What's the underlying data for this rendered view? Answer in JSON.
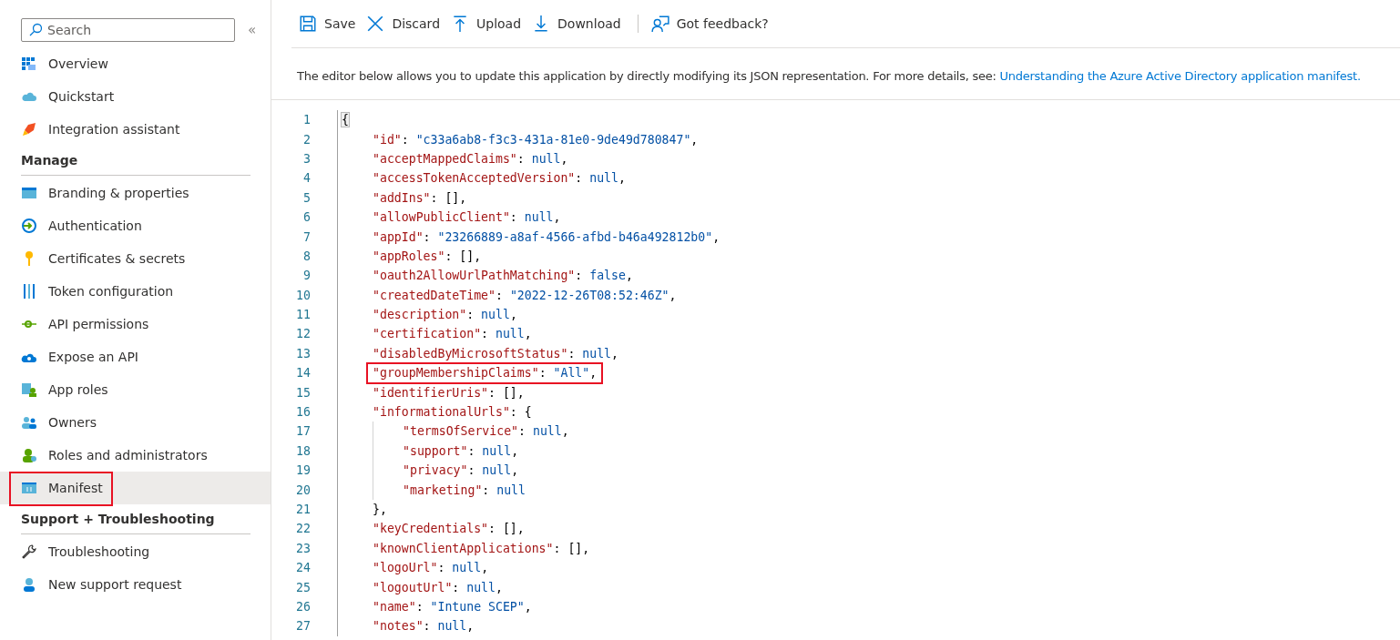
{
  "sidebar": {
    "search": {
      "placeholder": "Search"
    },
    "collapse": "«",
    "sections": [
      {
        "items": [
          {
            "label": "Overview",
            "selected": false,
            "highlighted": false
          },
          {
            "label": "Quickstart",
            "selected": false,
            "highlighted": false
          },
          {
            "label": "Integration assistant",
            "selected": false,
            "highlighted": false
          }
        ]
      },
      {
        "heading": "Manage",
        "items": [
          {
            "label": "Branding & properties",
            "selected": false,
            "highlighted": false
          },
          {
            "label": "Authentication",
            "selected": false,
            "highlighted": false
          },
          {
            "label": "Certificates & secrets",
            "selected": false,
            "highlighted": false
          },
          {
            "label": "Token configuration",
            "selected": false,
            "highlighted": false
          },
          {
            "label": "API permissions",
            "selected": false,
            "highlighted": false
          },
          {
            "label": "Expose an API",
            "selected": false,
            "highlighted": false
          },
          {
            "label": "App roles",
            "selected": false,
            "highlighted": false
          },
          {
            "label": "Owners",
            "selected": false,
            "highlighted": false
          },
          {
            "label": "Roles and administrators",
            "selected": false,
            "highlighted": false
          },
          {
            "label": "Manifest",
            "selected": true,
            "highlighted": true
          }
        ]
      },
      {
        "heading": "Support + Troubleshooting",
        "items": [
          {
            "label": "Troubleshooting",
            "selected": false,
            "highlighted": false
          },
          {
            "label": "New support request",
            "selected": false,
            "highlighted": false
          }
        ]
      }
    ]
  },
  "toolbar": [
    {
      "label": "Save",
      "kind": "save"
    },
    {
      "label": "Discard",
      "kind": "discard"
    },
    {
      "label": "Upload",
      "kind": "upload"
    },
    {
      "label": "Download",
      "kind": "download"
    },
    {
      "label": "Got feedback?",
      "kind": "feedback"
    }
  ],
  "description": {
    "text": "The editor below allows you to update this application by directly modifying its JSON representation. For more details, see:",
    "link": "Understanding the Azure Active Directory application manifest."
  },
  "editor": {
    "lines": [
      {
        "number": "1",
        "tokens": [
          {
            "kind": "punct",
            "t": "{"
          }
        ],
        "children": [
          {
            "number": "2",
            "tokens": [
              {
                "kind": "key",
                "t": "\"id\""
              },
              {
                "kind": "punct",
                "t": ": "
              },
              {
                "kind": "string",
                "t": "\"c33a6ab8-f3c3-431a-81e0-9de49d780847\""
              },
              {
                "kind": "punct",
                "t": ","
              }
            ]
          },
          {
            "number": "3",
            "tokens": [
              {
                "kind": "key",
                "t": "\"acceptMappedClaims\""
              },
              {
                "kind": "punct",
                "t": ": "
              },
              {
                "kind": "literal",
                "t": "null"
              },
              {
                "kind": "punct",
                "t": ","
              }
            ]
          },
          {
            "number": "4",
            "tokens": [
              {
                "kind": "key",
                "t": "\"accessTokenAcceptedVersion\""
              },
              {
                "kind": "punct",
                "t": ": "
              },
              {
                "kind": "literal",
                "t": "null"
              },
              {
                "kind": "punct",
                "t": ","
              }
            ]
          },
          {
            "number": "5",
            "tokens": [
              {
                "kind": "key",
                "t": "\"addIns\""
              },
              {
                "kind": "punct",
                "t": ": [],"
              }
            ]
          },
          {
            "number": "6",
            "tokens": [
              {
                "kind": "key",
                "t": "\"allowPublicClient\""
              },
              {
                "kind": "punct",
                "t": ": "
              },
              {
                "kind": "literal",
                "t": "null"
              },
              {
                "kind": "punct",
                "t": ","
              }
            ]
          },
          {
            "number": "7",
            "tokens": [
              {
                "kind": "key",
                "t": "\"appId\""
              },
              {
                "kind": "punct",
                "t": ": "
              },
              {
                "kind": "string",
                "t": "\"23266889-a8af-4566-afbd-b46a492812b0\""
              },
              {
                "kind": "punct",
                "t": ","
              }
            ]
          },
          {
            "number": "8",
            "tokens": [
              {
                "kind": "key",
                "t": "\"appRoles\""
              },
              {
                "kind": "punct",
                "t": ": [],"
              }
            ]
          },
          {
            "number": "9",
            "tokens": [
              {
                "kind": "key",
                "t": "\"oauth2AllowUrlPathMatching\""
              },
              {
                "kind": "punct",
                "t": ": "
              },
              {
                "kind": "literal",
                "t": "false"
              },
              {
                "kind": "punct",
                "t": ","
              }
            ]
          },
          {
            "number": "10",
            "tokens": [
              {
                "kind": "key",
                "t": "\"createdDateTime\""
              },
              {
                "kind": "punct",
                "t": ": "
              },
              {
                "kind": "string",
                "t": "\"2022-12-26T08:52:46Z\""
              },
              {
                "kind": "punct",
                "t": ","
              }
            ]
          },
          {
            "number": "11",
            "tokens": [
              {
                "kind": "key",
                "t": "\"description\""
              },
              {
                "kind": "punct",
                "t": ": "
              },
              {
                "kind": "literal",
                "t": "null"
              },
              {
                "kind": "punct",
                "t": ","
              }
            ]
          },
          {
            "number": "12",
            "tokens": [
              {
                "kind": "key",
                "t": "\"certification\""
              },
              {
                "kind": "punct",
                "t": ": "
              },
              {
                "kind": "literal",
                "t": "null"
              },
              {
                "kind": "punct",
                "t": ","
              }
            ]
          },
          {
            "number": "13",
            "tokens": [
              {
                "kind": "key",
                "t": "\"disabledByMicrosoftStatus\""
              },
              {
                "kind": "punct",
                "t": ": "
              },
              {
                "kind": "literal",
                "t": "null"
              },
              {
                "kind": "punct",
                "t": ","
              }
            ]
          },
          {
            "number": "14",
            "highlighted": true,
            "tokens": [
              {
                "kind": "key",
                "t": "\"groupMembershipClaims\""
              },
              {
                "kind": "punct",
                "t": ": "
              },
              {
                "kind": "string",
                "t": "\"All\""
              },
              {
                "kind": "punct",
                "t": ","
              }
            ]
          },
          {
            "number": "15",
            "tokens": [
              {
                "kind": "key",
                "t": "\"identifierUris\""
              },
              {
                "kind": "punct",
                "t": ": [],"
              }
            ]
          },
          {
            "number": "16",
            "tokens": [
              {
                "kind": "key",
                "t": "\"informationalUrls\""
              },
              {
                "kind": "punct",
                "t": ": {"
              }
            ],
            "children": [
              {
                "number": "17",
                "tokens": [
                  {
                    "kind": "key",
                    "t": "\"termsOfService\""
                  },
                  {
                    "kind": "punct",
                    "t": ": "
                  },
                  {
                    "kind": "literal",
                    "t": "null"
                  },
                  {
                    "kind": "punct",
                    "t": ","
                  }
                ]
              },
              {
                "number": "18",
                "tokens": [
                  {
                    "kind": "key",
                    "t": "\"support\""
                  },
                  {
                    "kind": "punct",
                    "t": ": "
                  },
                  {
                    "kind": "literal",
                    "t": "null"
                  },
                  {
                    "kind": "punct",
                    "t": ","
                  }
                ]
              },
              {
                "number": "19",
                "tokens": [
                  {
                    "kind": "key",
                    "t": "\"privacy\""
                  },
                  {
                    "kind": "punct",
                    "t": ": "
                  },
                  {
                    "kind": "literal",
                    "t": "null"
                  },
                  {
                    "kind": "punct",
                    "t": ","
                  }
                ]
              },
              {
                "number": "20",
                "tokens": [
                  {
                    "kind": "key",
                    "t": "\"marketing\""
                  },
                  {
                    "kind": "punct",
                    "t": ": "
                  },
                  {
                    "kind": "literal",
                    "t": "null"
                  }
                ]
              }
            ]
          },
          {
            "number": "21",
            "tokens": [
              {
                "kind": "punct",
                "t": "},"
              }
            ]
          },
          {
            "number": "22",
            "tokens": [
              {
                "kind": "key",
                "t": "\"keyCredentials\""
              },
              {
                "kind": "punct",
                "t": ": [],"
              }
            ]
          },
          {
            "number": "23",
            "tokens": [
              {
                "kind": "key",
                "t": "\"knownClientApplications\""
              },
              {
                "kind": "punct",
                "t": ": [],"
              }
            ]
          },
          {
            "number": "24",
            "tokens": [
              {
                "kind": "key",
                "t": "\"logoUrl\""
              },
              {
                "kind": "punct",
                "t": ": "
              },
              {
                "kind": "literal",
                "t": "null"
              },
              {
                "kind": "punct",
                "t": ","
              }
            ]
          },
          {
            "number": "25",
            "tokens": [
              {
                "kind": "key",
                "t": "\"logoutUrl\""
              },
              {
                "kind": "punct",
                "t": ": "
              },
              {
                "kind": "literal",
                "t": "null"
              },
              {
                "kind": "punct",
                "t": ","
              }
            ]
          },
          {
            "number": "26",
            "tokens": [
              {
                "kind": "key",
                "t": "\"name\""
              },
              {
                "kind": "punct",
                "t": ": "
              },
              {
                "kind": "string",
                "t": "\"Intune SCEP\""
              },
              {
                "kind": "punct",
                "t": ","
              }
            ]
          },
          {
            "number": "27",
            "tokens": [
              {
                "kind": "key",
                "t": "\"notes\""
              },
              {
                "kind": "punct",
                "t": ": "
              },
              {
                "kind": "literal",
                "t": "null"
              },
              {
                "kind": "punct",
                "t": ","
              }
            ]
          }
        ]
      }
    ]
  }
}
